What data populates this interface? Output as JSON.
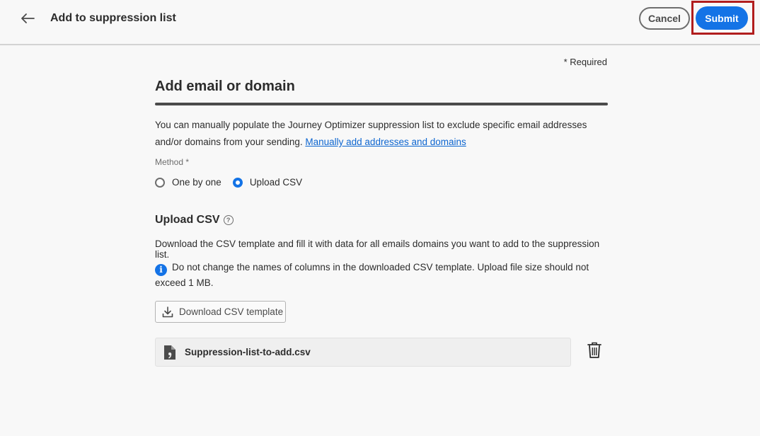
{
  "header": {
    "title": "Add to suppression list",
    "cancel_label": "Cancel",
    "submit_label": "Submit"
  },
  "form": {
    "required_note": "* Required",
    "section_title": "Add email or domain",
    "description_text": "You can manually populate the Journey Optimizer suppression list to exclude specific email addresses and/or domains from your sending. ",
    "description_link": "Manually add addresses and domains",
    "method_label": "Method",
    "method_required_mark": "*",
    "method_options": [
      {
        "label": "One by one",
        "selected": false
      },
      {
        "label": "Upload CSV",
        "selected": true
      }
    ]
  },
  "upload": {
    "title": "Upload CSV",
    "description": "Download the CSV template and fill it with data for all emails domains you want to add to the suppression list.",
    "info_text": "Do not change the names of columns in the downloaded CSV template. Upload file size should not exceed 1 MB.",
    "download_label": "Download CSV template",
    "file_name": "Suppression-list-to-add.csv"
  },
  "colors": {
    "accent": "#1473e6",
    "highlight": "#b11d1d",
    "link": "#0d66d0"
  },
  "icons": [
    "back-arrow-icon",
    "help-icon",
    "info-icon",
    "download-icon",
    "csv-file-icon",
    "trash-icon"
  ]
}
